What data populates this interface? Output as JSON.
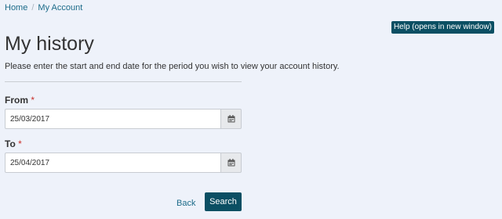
{
  "breadcrumb": {
    "home": "Home",
    "separator": "/",
    "current": "My Account"
  },
  "help_button": "Help (opens in new window)",
  "title": "My history",
  "intro": "Please enter the start and end date for the period you wish to view your account history.",
  "form": {
    "from": {
      "label": "From",
      "required_mark": "*",
      "value": "25/03/2017",
      "icon": "calendar-icon"
    },
    "to": {
      "label": "To",
      "required_mark": "*",
      "value": "25/04/2017",
      "icon": "calendar-icon"
    }
  },
  "actions": {
    "back": "Back",
    "search": "Search"
  },
  "colors": {
    "background": "#eef2fa",
    "primary": "#0b4f63",
    "link": "#1c6b89",
    "required": "#c9302c"
  }
}
